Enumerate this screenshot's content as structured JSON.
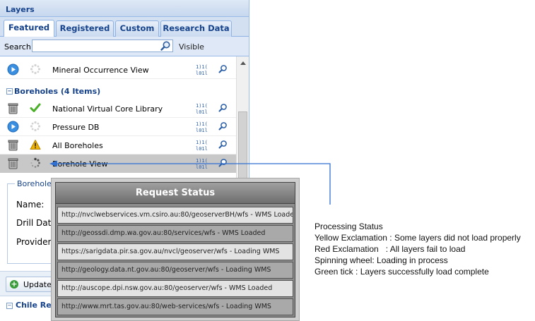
{
  "panel": {
    "title": "Layers",
    "tabs": [
      {
        "label": "Featured",
        "active": true
      },
      {
        "label": "Registered",
        "active": false
      },
      {
        "label": "Custom",
        "active": false
      },
      {
        "label": "Research Data",
        "active": false
      }
    ],
    "search": {
      "label": "Search:",
      "value": "",
      "placeholder": ""
    },
    "visible_label": "Visible",
    "list": {
      "rows": [
        {
          "name": "Mineral Occurrence View",
          "status_icon": "play-icon",
          "load_icon": "spinner-idle-icon",
          "selected": false
        },
        {
          "group": "Boreholes (4 Items)"
        },
        {
          "name": "National Virtual Core Library",
          "status_icon": "trash-icon",
          "load_icon": "green-tick-icon",
          "selected": false
        },
        {
          "name": "Pressure DB",
          "status_icon": "play-icon",
          "load_icon": "spinner-idle-icon",
          "selected": false
        },
        {
          "name": "All Boreholes",
          "status_icon": "trash-icon",
          "load_icon": "yellow-exclamation-icon",
          "selected": false
        },
        {
          "name": "Borehole View",
          "status_icon": "trash-icon",
          "load_icon": "spinning-wheel-icon",
          "selected": true
        }
      ]
    },
    "details": {
      "legend": "Borehole V",
      "fields": [
        "Name:",
        "Drill Date",
        "Provider:"
      ]
    },
    "update_button": "Update",
    "next_group": "Chile Reg"
  },
  "request_status": {
    "title": "Request Status",
    "rows": [
      "http://nvclwebservices.vm.csiro.au:80/geoserverBH/wfs - WMS Loaded",
      "http://geossdi.dmp.wa.gov.au:80/services/wfs - WMS Loaded",
      "https://sarigdata.pir.sa.gov.au/nvcl/geoserver/wfs - Loading WMS",
      "http://geology.data.nt.gov.au:80/geoserver/wfs - Loading WMS",
      "http://auscope.dpi.nsw.gov.au:80/geoserver/wfs - WMS Loaded",
      "http://www.mrt.tas.gov.au:80/web-services/wfs - Loading WMS"
    ]
  },
  "legend": {
    "title": "Processing Status",
    "items": [
      "Yellow Exclamation : Some layers did not load properly",
      "Red Exclamation   : All layers fail to load",
      "Spinning wheel: Loading in process",
      "Green tick : Layers successfully load complete"
    ]
  },
  "colors": {
    "accent": "#15428b",
    "arrow": "#2f6fd1",
    "tick": "#4caf2a",
    "warning": "#f0b400",
    "play": "#3b8fe0"
  }
}
